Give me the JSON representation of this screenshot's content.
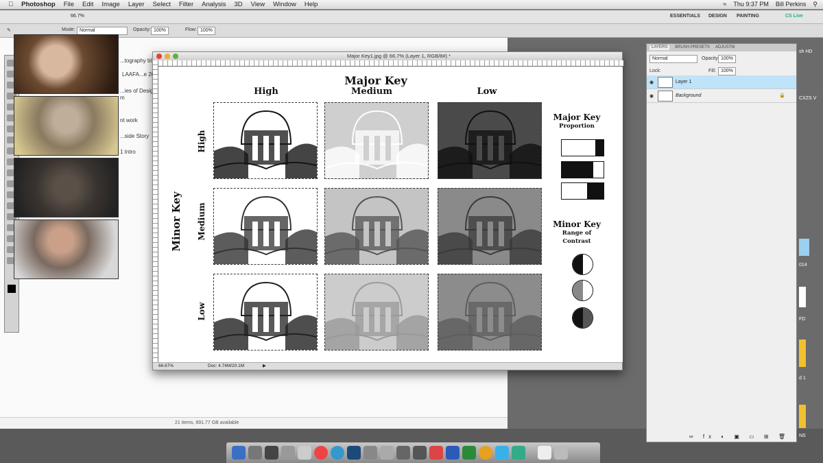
{
  "menubar": {
    "app": "Photoshop",
    "items": [
      "File",
      "Edit",
      "Image",
      "Layer",
      "Select",
      "Filter",
      "Analysis",
      "3D",
      "View",
      "Window",
      "Help"
    ],
    "clock": "Thu 9:37 PM",
    "user": "Bill Perkins"
  },
  "appbar": {
    "zoom": "66.7%",
    "workspaces": [
      "ESSENTIALS",
      "DESIGN",
      "PAINTING"
    ],
    "cs_live": "CS Live"
  },
  "options": {
    "mode_label": "Mode:",
    "mode": "Normal",
    "opacity_label": "Opacity:",
    "opacity": "100%",
    "flow_label": "Flow:",
    "flow": "100%"
  },
  "finder": {
    "items": [
      "...tography bl",
      "LAAFA...e 20",
      "...ies of Design",
      "m",
      "nt work",
      "...side Story",
      "1 Intro"
    ],
    "status": "21 items, 891.77 GB available"
  },
  "document": {
    "title": "Major Key1.jpg @ 66.7% (Layer 1, RGB/8#) *",
    "zoom": "66.67%",
    "doc_size": "Doc: 4.74M/20.1M",
    "heading": "Major Key",
    "columns": [
      "High",
      "Medium",
      "Low"
    ],
    "rows": [
      "High",
      "Medium",
      "Low"
    ],
    "side_heading": "Minor Key",
    "tones": [
      [
        [
          "#ffffff",
          "#151515"
        ],
        [
          "#cfcfcf",
          "#ffffff"
        ],
        [
          "#4a4a4a",
          "#101010"
        ]
      ],
      [
        [
          "#ffffff",
          "#333333"
        ],
        [
          "#c4c4c4",
          "#555555"
        ],
        [
          "#8a8a8a",
          "#3a3a3a"
        ]
      ],
      [
        [
          "#ffffff",
          "#222222"
        ],
        [
          "#cccccc",
          "#9a9a9a"
        ],
        [
          "#8c8c8c",
          "#5e5e5e"
        ]
      ]
    ],
    "legend": {
      "major_title": "Major Key",
      "major_sub": "Proportion",
      "proportions_dark": [
        0.2,
        0.75,
        0.4
      ],
      "minor_title": "Minor Key",
      "minor_sub1": "Range of",
      "minor_sub2": "Contrast",
      "contrast_pairs": [
        [
          "#111111",
          "#ffffff"
        ],
        [
          "#888888",
          "#ffffff"
        ],
        [
          "#111111",
          "#555555"
        ]
      ]
    }
  },
  "layers": {
    "tabs": [
      "LAYERS",
      "BRUSH PRESETS",
      "ADJUSTM"
    ],
    "blend": "Normal",
    "opacity_label": "Opacity:",
    "opacity": "100%",
    "lock_label": "Lock:",
    "fill_label": "Fill:",
    "fill": "100%",
    "items": [
      {
        "name": "Layer 1",
        "selected": true
      },
      {
        "name": "Background",
        "locked": true
      }
    ]
  },
  "desktop": {
    "icons": [
      "sh HD",
      "CXZS V",
      "014",
      "FD",
      "d 1",
      "NS"
    ]
  }
}
